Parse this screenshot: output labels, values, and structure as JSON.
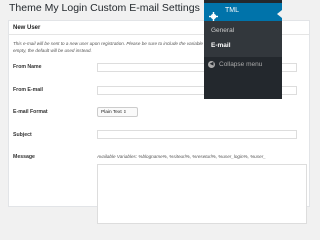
{
  "page": {
    "title": "Theme My Login Custom E-mail Settings"
  },
  "section": {
    "title": "New User",
    "description_1": "This e-mail will be sent to a new user upon registration. Please be sure to include the variable",
    "description_2": "empty, the default will be used instead."
  },
  "fields": {
    "from_name_label": "From Name",
    "from_email_label": "From E-mail",
    "format_label": "E-mail Format",
    "format_value": "Plain Text",
    "subject_label": "Subject",
    "message_label": "Message",
    "available_variables": "Available Variables: %blogname%, %siteurl%, %reseturl%, %user_login%, %user_"
  },
  "admin_menu": {
    "header": "TML",
    "header_icon": "gear-icon",
    "items": [
      {
        "label": "General",
        "current": false
      },
      {
        "label": "E-mail",
        "current": true
      }
    ],
    "collapse": "Collapse menu"
  },
  "colors": {
    "menu_bg": "#23282d",
    "menu_active": "#0073aa",
    "submenu_bg": "#32373c"
  }
}
